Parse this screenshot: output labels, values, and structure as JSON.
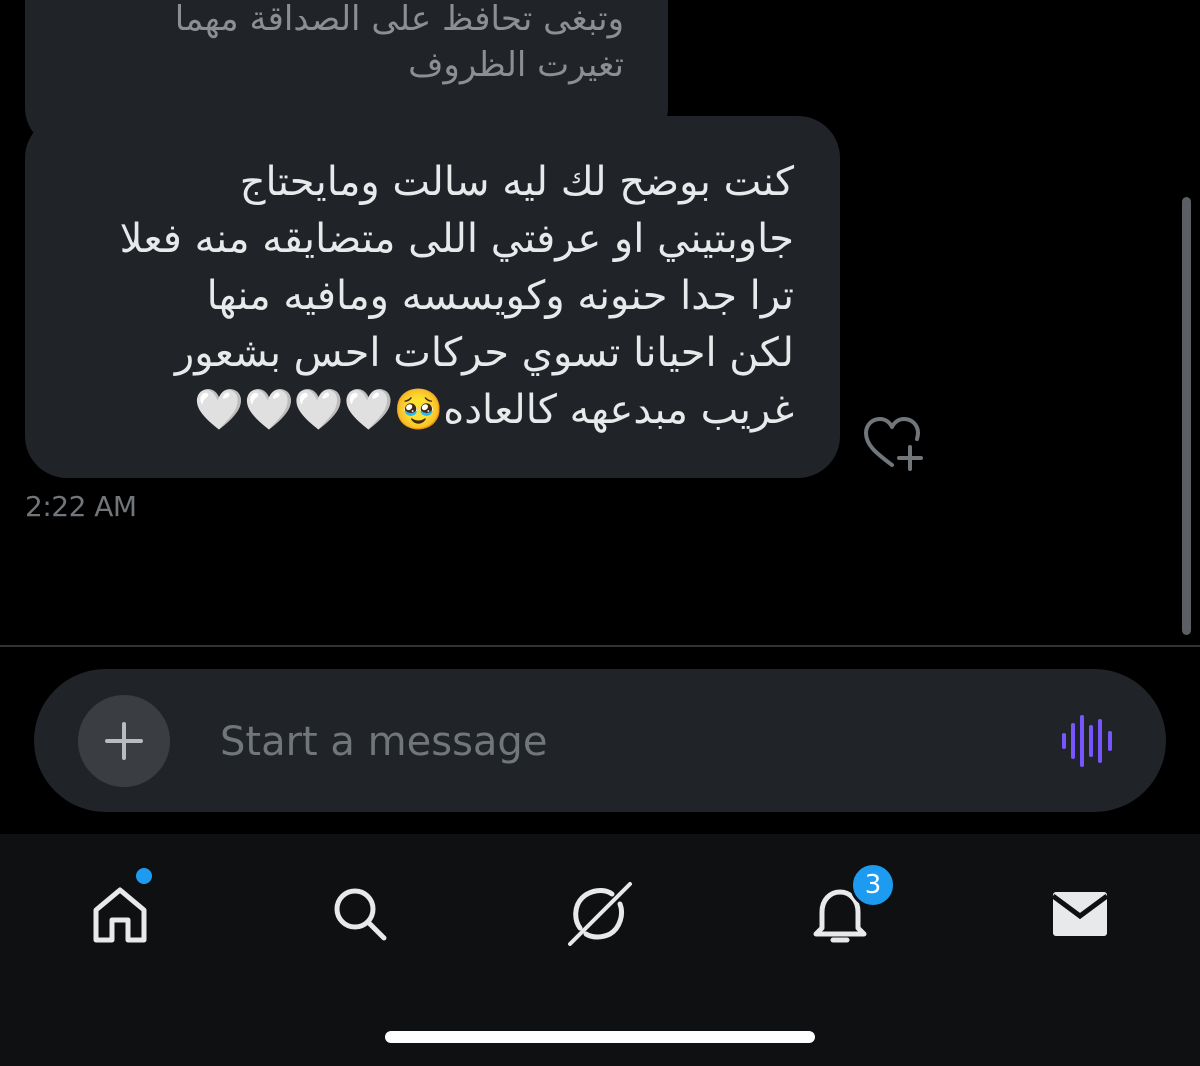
{
  "conversation": {
    "previous_message": {
      "lines": [
        "وتبغى تحافظ على الصداقة مهما",
        "تغيرت الظروف"
      ]
    },
    "message": {
      "lines": [
        "كنت بوضح لك ليه سالت ومايحتاج",
        "جاوبتيني او عرفتي اللى متضايقه منه فعلا",
        "ترا جدا حنونه وكويسسه ومافيه منها",
        "لكن احيانا تسوي حركات احس بشعور",
        "غريب مبدعهه كالعاده🥹🤍🤍🤍🤍"
      ],
      "timestamp": "2:22 AM",
      "react_icon": "heart-plus-icon"
    }
  },
  "composer": {
    "placeholder": "Start a message",
    "value": "",
    "add_icon": "plus-icon",
    "voice_icon": "audio-waveform-icon",
    "voice_color": "#7856ff"
  },
  "nav": {
    "items": [
      {
        "name": "home",
        "icon": "home-icon",
        "has_dot": true
      },
      {
        "name": "search",
        "icon": "search-icon"
      },
      {
        "name": "grok",
        "icon": "grok-icon"
      },
      {
        "name": "notifications",
        "icon": "bell-icon",
        "badge": "3"
      },
      {
        "name": "messages",
        "icon": "envelope-icon"
      }
    ],
    "accent": "#1d9bf0"
  }
}
